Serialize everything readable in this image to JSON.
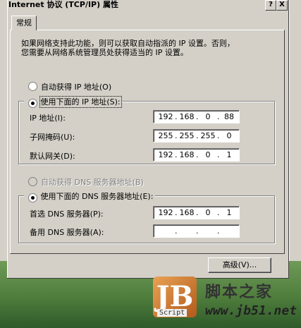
{
  "window": {
    "title": "Internet 协议 (TCP/IP) 属性",
    "help_btn": "?",
    "close_btn": "X"
  },
  "tabs": [
    {
      "label": "常规"
    }
  ],
  "intro_text_line1": "如果网络支持此功能，则可以获取自动指派的 IP 设置。否则，",
  "intro_text_line2": "您需要从网络系统管理员处获得适当的 IP 设置。",
  "ip_mode": {
    "auto_label": "自动获得 IP 地址(O)",
    "manual_label": "使用下面的 IP 地址(S):",
    "selected": "manual"
  },
  "ip_fields": [
    {
      "label": "IP 地址(I):",
      "octets": [
        "192",
        "168",
        "0",
        "88"
      ]
    },
    {
      "label": "子网掩码(U):",
      "octets": [
        "255",
        "255",
        "255",
        "0"
      ]
    },
    {
      "label": "默认网关(D):",
      "octets": [
        "192",
        "168",
        "0",
        "1"
      ]
    }
  ],
  "dns_mode": {
    "auto_label": "自动获得 DNS 服务器地址(B)",
    "manual_label": "使用下面的 DNS 服务器地址(E):",
    "selected": "manual",
    "auto_disabled": true
  },
  "dns_fields": [
    {
      "label": "首选 DNS 服务器(P):",
      "octets": [
        "192",
        "168",
        "0",
        "1"
      ]
    },
    {
      "label": "备用 DNS 服务器(A):",
      "octets": [
        "",
        "",
        "",
        ""
      ]
    }
  ],
  "advanced_button": "高级(V)...",
  "watermark": {
    "logo_letters": "JB",
    "script_label": "Script",
    "site_name_cn": "脚本之家",
    "site_url": "www.jb51.net"
  }
}
